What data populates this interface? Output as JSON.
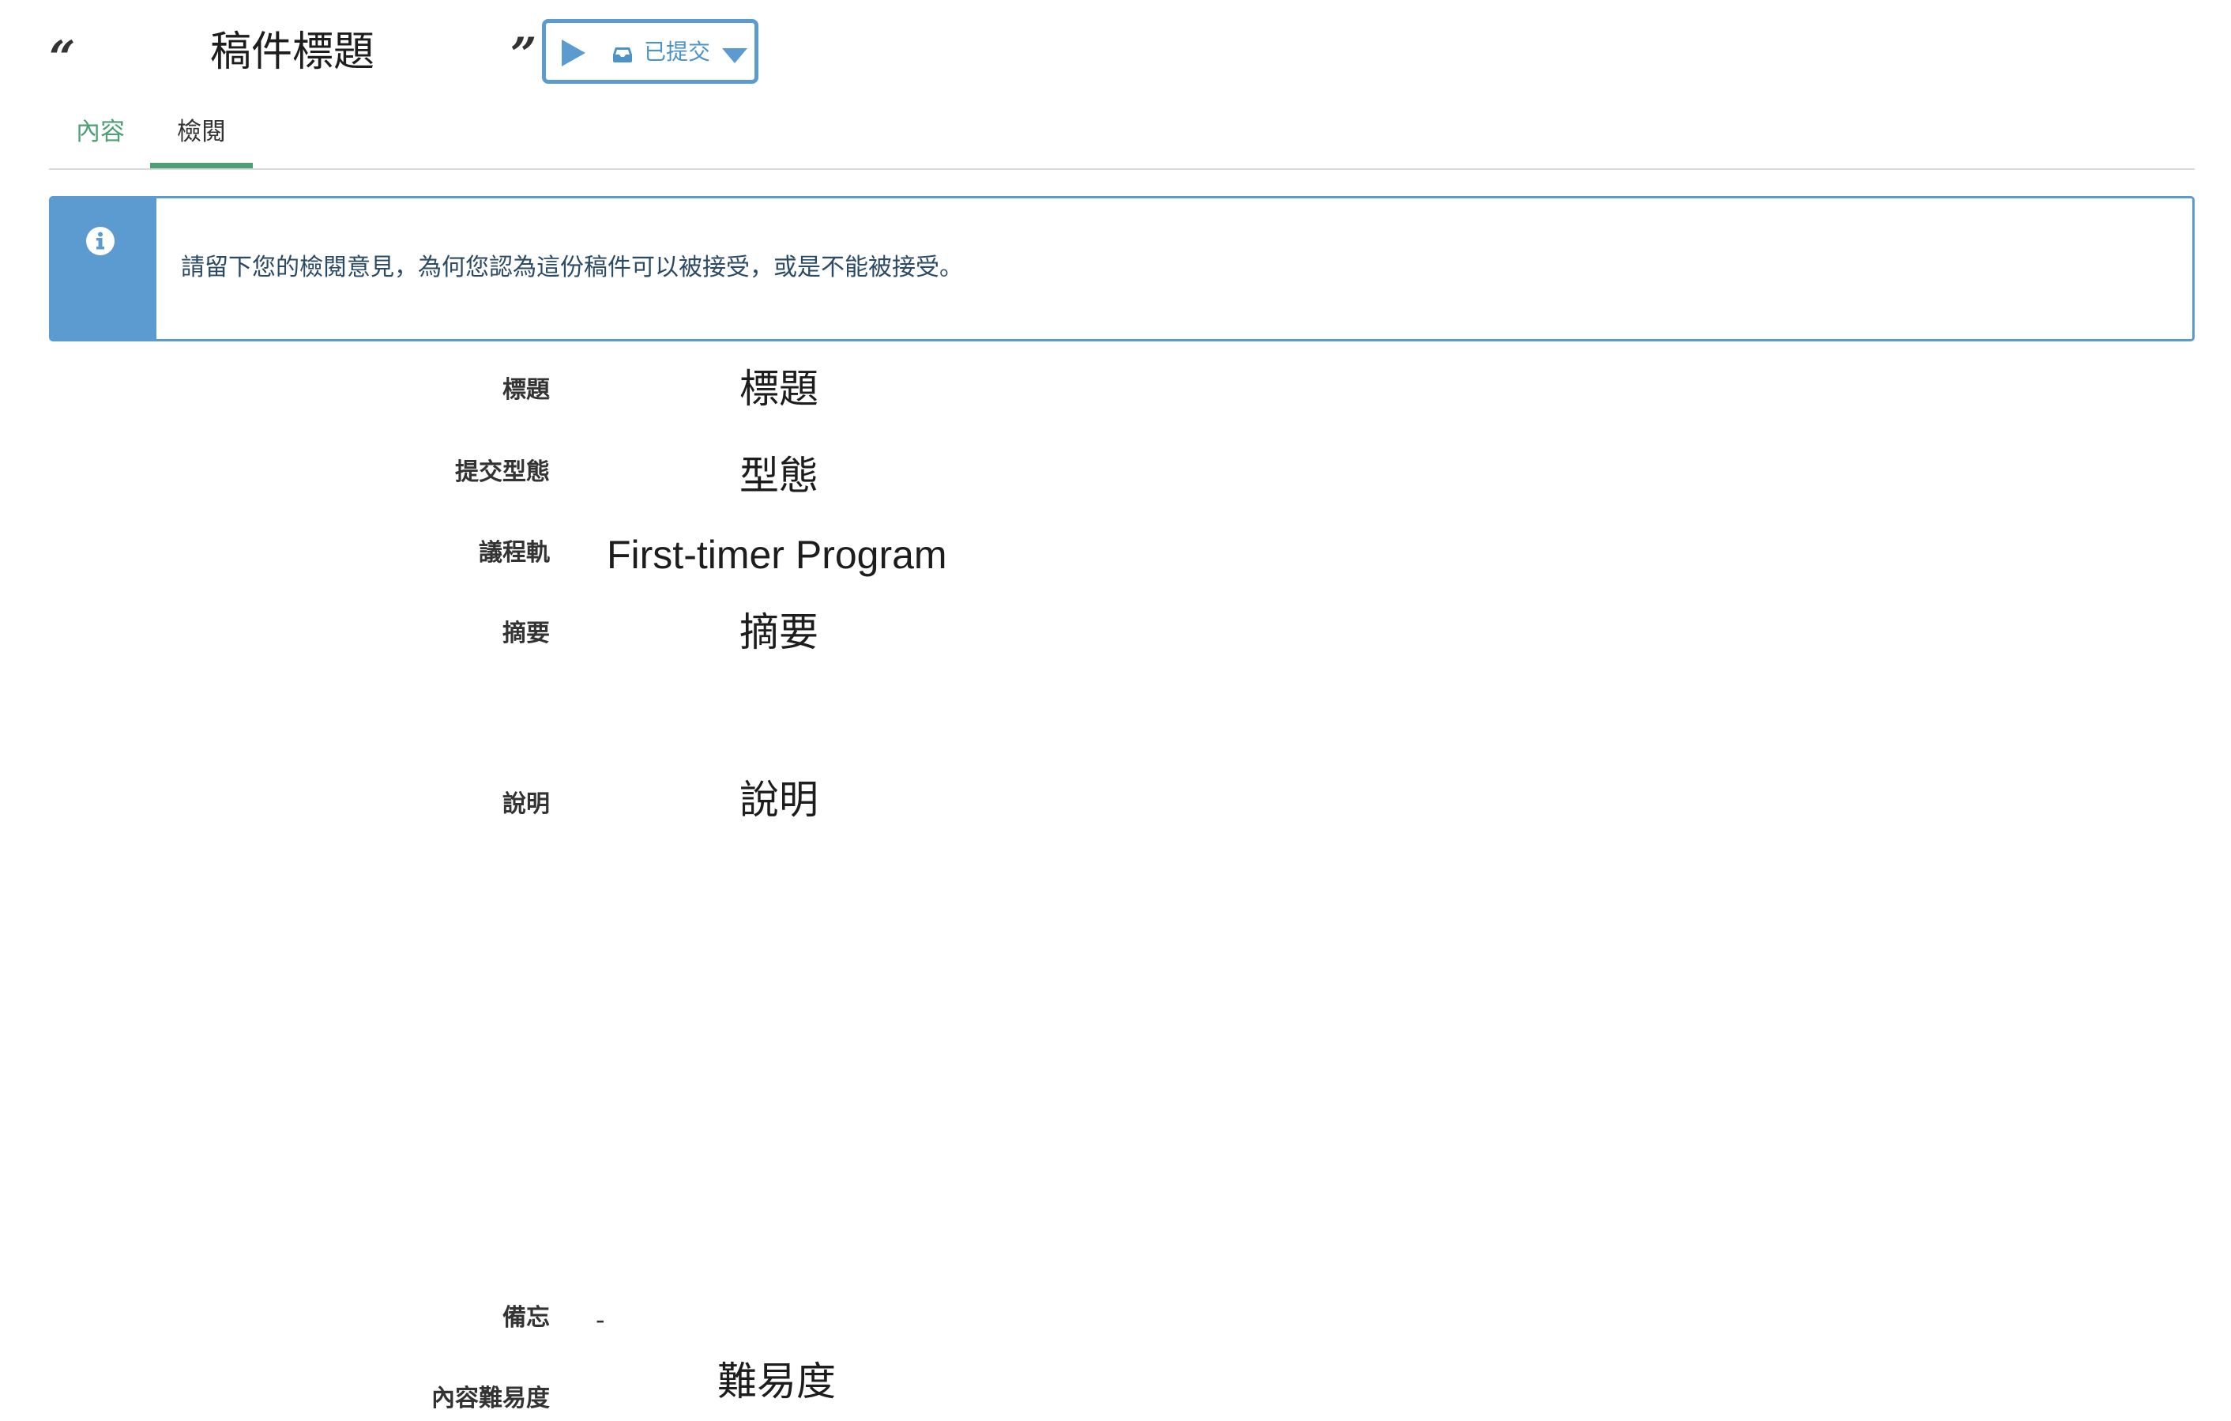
{
  "header": {
    "open_quote": "“",
    "close_quote": "”",
    "title": "稿件標題",
    "status_button": {
      "label": "已提交",
      "icons": [
        "play-icon",
        "inbox-icon",
        "caret-down-icon"
      ],
      "accent_color": "#5b9bd0"
    }
  },
  "tabs": [
    {
      "label": "內容",
      "active": false,
      "color": "#4e9f74"
    },
    {
      "label": "檢閱",
      "active": true
    }
  ],
  "alert": {
    "icon": "info-icon",
    "message": "請留下您的檢閱意見，為何您認為這份稿件可以被接受，或是不能被接受。",
    "color": "#5b9bd0"
  },
  "fields": [
    {
      "label": "標題",
      "value": "標題"
    },
    {
      "label": "提交型態",
      "value": "型態"
    },
    {
      "label": "議程軌",
      "value": "First-timer Program"
    },
    {
      "label": "摘要",
      "value": "摘要"
    },
    {
      "label": "說明",
      "value": "說明"
    },
    {
      "label": "備忘",
      "value": "-"
    },
    {
      "label": "內容難易度",
      "value": "難易度"
    }
  ]
}
